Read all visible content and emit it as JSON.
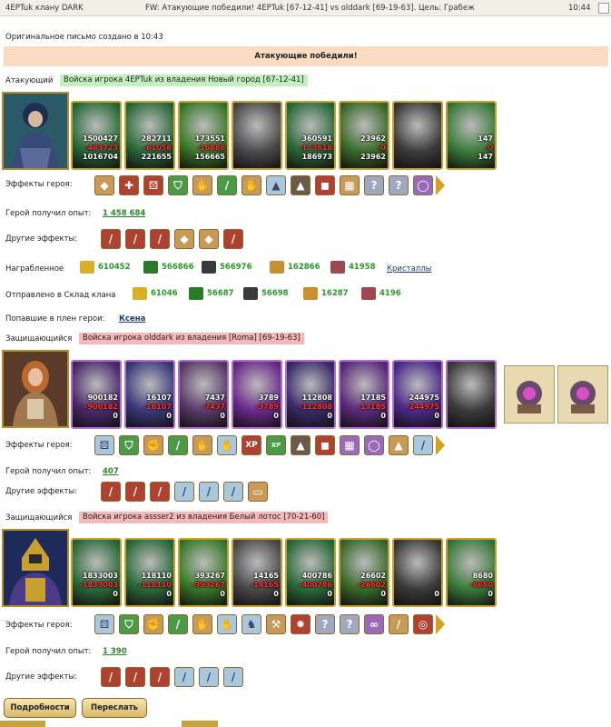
{
  "titlebar": {
    "sender": "4EPTuk клану DARK",
    "subject": "FW: Атакующие победили! 4EPTuk [67-12-41] vs olddark [69-19-63]. Цель: Грабеж",
    "time": "10:44"
  },
  "original_note": "Оригинальное письмо создано в 10:43",
  "banner": "Атакующие победили!",
  "attacker": {
    "role_label": "Атакующий",
    "army_tag": "Войска игрока 4EPTuk из владения Новый город [67-12-41]",
    "units": [
      {
        "n1": "1500427",
        "n2": "-483723",
        "n3": "1016704"
      },
      {
        "n1": "282711",
        "n2": "-61056",
        "n3": "221655"
      },
      {
        "n1": "173551",
        "n2": "-16886",
        "n3": "156665"
      },
      {
        "n1": "",
        "n2": "",
        "n3": ""
      },
      {
        "n1": "360591",
        "n2": "-173618",
        "n3": "186973"
      },
      {
        "n1": "23962",
        "n2": "-0",
        "n3": "23962"
      },
      {
        "n1": "",
        "n2": "",
        "n3": ""
      },
      {
        "n1": "147",
        "n2": "-0",
        "n3": "147"
      }
    ],
    "hero_effects_label": "Эффекты героя:",
    "xp_label": "Герой получил опыт:",
    "xp_value": "1 458 684",
    "other_effects_label": "Другие эффекты:",
    "loot_label": "Награбленное",
    "loot": [
      "610452",
      "566866",
      "566976",
      "162866",
      "41958"
    ],
    "loot_link": "Кристаллы",
    "sent_label": "Отправлено в Склад клана",
    "sent": [
      "61046",
      "56687",
      "56698",
      "16287",
      "4196"
    ],
    "captured_label": "Попавшие в плен герои:",
    "captured_name": "Ксена"
  },
  "defender1": {
    "role_label": "Защищающийся",
    "army_tag": "Войска игрока olddark из владения [Roma] [69-19-63]",
    "units": [
      {
        "n1": "900182",
        "n2": "-900182",
        "n3": "0"
      },
      {
        "n1": "16107",
        "n2": "-16107",
        "n3": "0"
      },
      {
        "n1": "7437",
        "n2": "-7437",
        "n3": "0"
      },
      {
        "n1": "3789",
        "n2": "-3789",
        "n3": "0"
      },
      {
        "n1": "112808",
        "n2": "-112808",
        "n3": "0"
      },
      {
        "n1": "17185",
        "n2": "-17185",
        "n3": "0"
      },
      {
        "n1": "244975",
        "n2": "-244975",
        "n3": "0"
      },
      {
        "n1": "",
        "n2": "",
        "n3": ""
      }
    ],
    "hero_effects_label": "Эффекты героя:",
    "xp_label": "Герой получил опыт:",
    "xp_value": "407",
    "other_effects_label": "Другие эффекты:"
  },
  "defender2": {
    "role_label": "Защищающийся",
    "army_tag": "Войска игрока assser2 из владения Белый лотос [70-21-60]",
    "units": [
      {
        "n1": "1833003",
        "n2": "-1833003",
        "n3": "0"
      },
      {
        "n1": "118110",
        "n2": "-118110",
        "n3": "0"
      },
      {
        "n1": "393267",
        "n2": "-393267",
        "n3": "0"
      },
      {
        "n1": "14165",
        "n2": "-14165",
        "n3": "0"
      },
      {
        "n1": "400786",
        "n2": "-400786",
        "n3": "0"
      },
      {
        "n1": "26602",
        "n2": "-26602",
        "n3": "0"
      },
      {
        "n1": "",
        "n2": "",
        "n3": "0"
      },
      {
        "n1": "8680",
        "n2": "-8680",
        "n3": "0"
      }
    ],
    "hero_effects_label": "Эффекты героя:",
    "xp_label": "Герой получил опыт:",
    "xp_value": "1 390",
    "other_effects_label": "Другие эффекты:"
  },
  "buttons": {
    "details": "Подробности",
    "forward": "Переслать"
  },
  "colors": {
    "win_banner": "#fadcc2",
    "attacker_tag": "#c4f0c0",
    "defender_tag": "#f6b8b8",
    "unit_gold": "#c8a030",
    "unit_purple": "#b070c8",
    "xp_green": "#2a8a2a"
  }
}
